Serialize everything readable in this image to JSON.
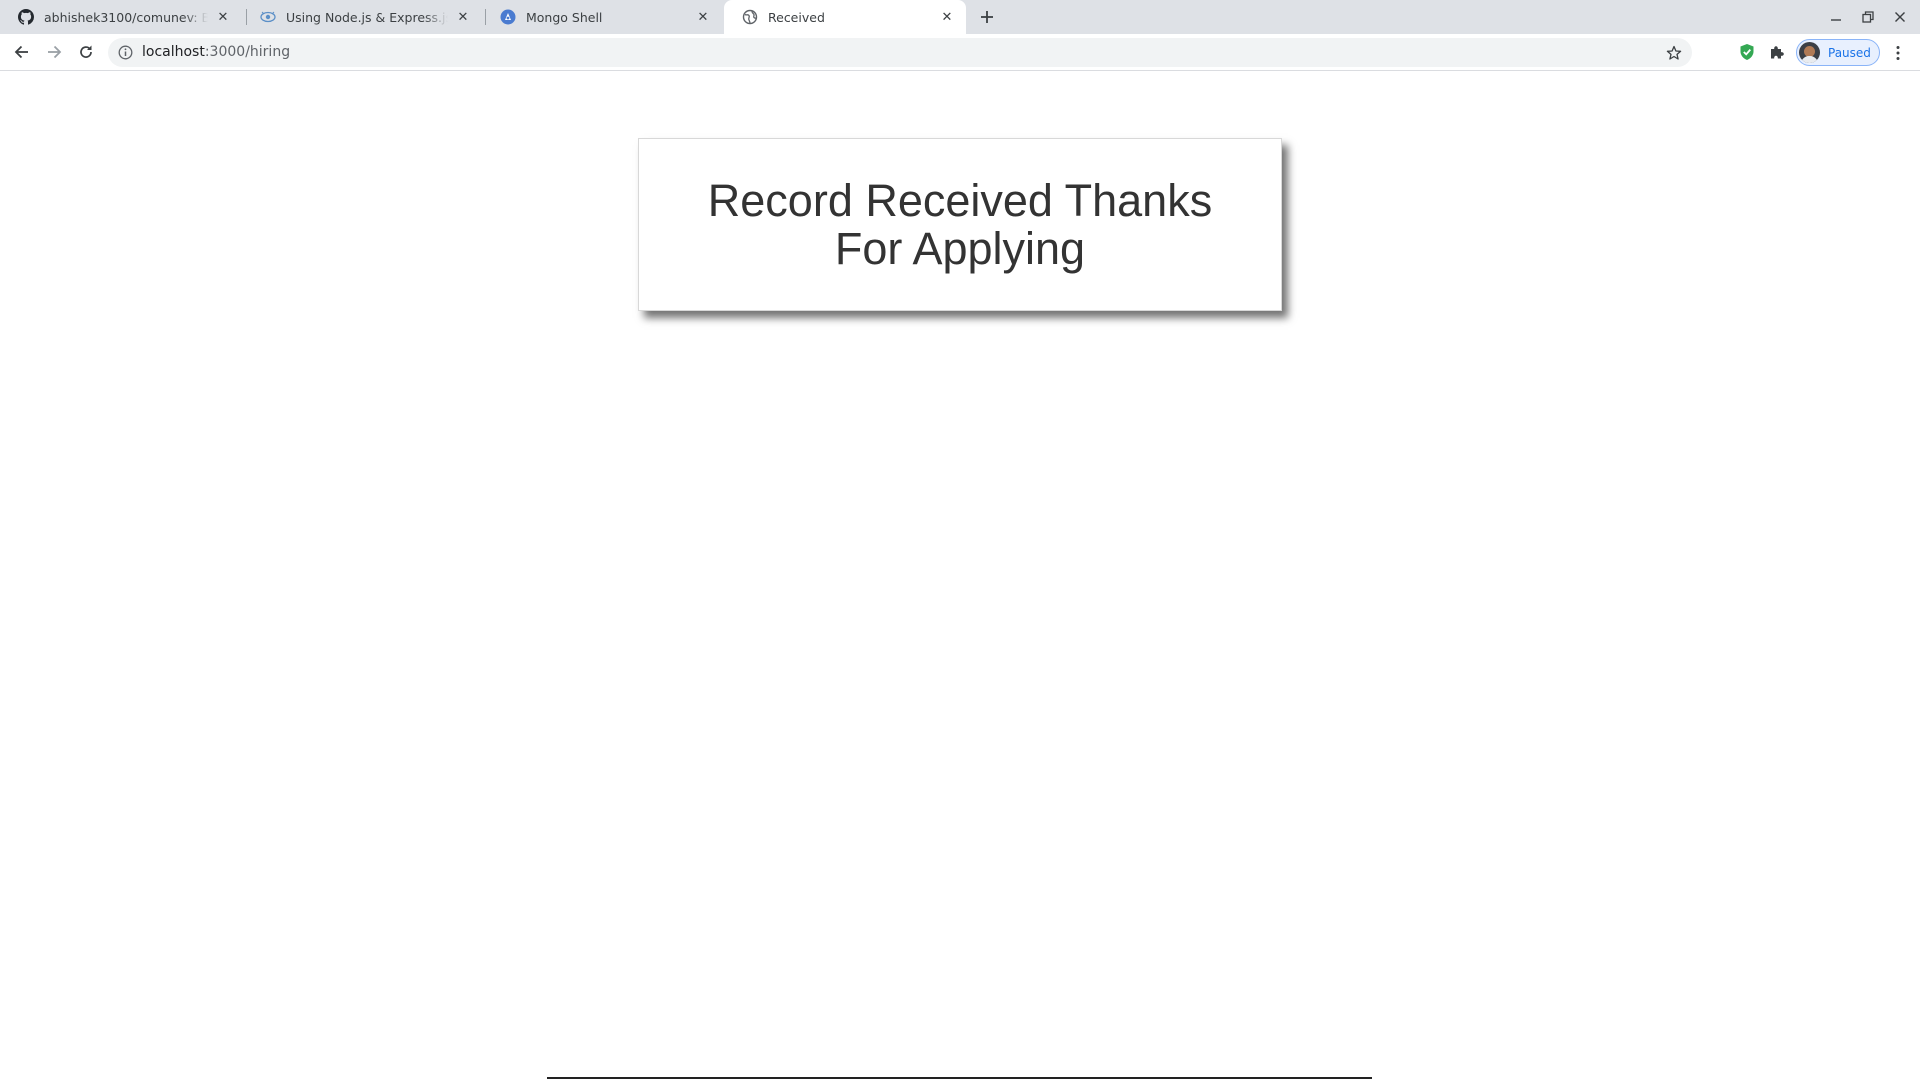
{
  "browser": {
    "tabs": [
      {
        "title": "abhishek3100/comunev: Backend",
        "favicon": "github-icon",
        "active": false
      },
      {
        "title": "Using Node.js & Express.js to save data",
        "favicon": "eye-logo-icon",
        "active": false
      },
      {
        "title": "Mongo Shell",
        "favicon": "mongo-shell-icon",
        "active": false
      },
      {
        "title": "Received",
        "favicon": "globe-icon",
        "active": true
      }
    ],
    "new_tab_icon": "plus-icon",
    "window_controls": [
      "minimize-icon",
      "restore-icon",
      "close-icon"
    ]
  },
  "toolbar": {
    "nav_icons": [
      "back-arrow-icon",
      "forward-arrow-icon",
      "reload-icon"
    ],
    "url_host": "localhost",
    "url_path": ":3000/hiring",
    "info_icon": "info-icon",
    "bookmark_icon": "star-icon",
    "extension_icons": [
      "shield-check-icon",
      "puzzle-piece-icon"
    ],
    "profile": {
      "label": "Paused",
      "avatar": "avatar-icon"
    },
    "menu_icon": "kebab-menu-icon"
  },
  "page": {
    "heading": "Record Received Thanks For Applying"
  },
  "colors": {
    "tabstrip_bg": "#dee1e6",
    "omnibox_bg": "#f1f3f4",
    "profile_accent": "#1a73e8",
    "shield_green": "#34a853",
    "heading_text": "#333333"
  }
}
